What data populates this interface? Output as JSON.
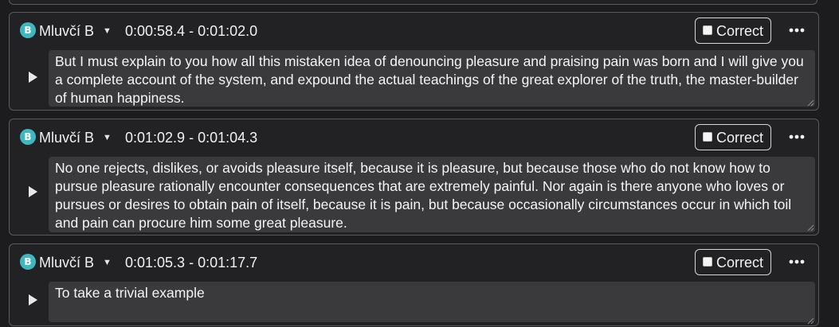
{
  "segments": [
    {
      "badge": "B",
      "speaker": "Mluvčí B",
      "time_range": "0:00:58.4 - 0:01:02.0",
      "correct_label": "Correct",
      "text": "But I must explain to you how all this mistaken idea of denouncing pleasure and praising pain was born and I will give you a complete account of the system, and expound the actual teachings of the great explorer of the truth, the master-builder of human happiness."
    },
    {
      "badge": "B",
      "speaker": "Mluvčí B",
      "time_range": "0:01:02.9 - 0:01:04.3",
      "correct_label": "Correct",
      "text": "No one rejects, dislikes, or avoids pleasure itself, because it is pleasure, but because those who do not know how to pursue pleasure rationally encounter consequences that are extremely painful. Nor again is there anyone who loves or pursues or desires to obtain pain of itself, because it is pain, but because occasionally circumstances occur in which toil and pain can procure him some great pleasure."
    },
    {
      "badge": "B",
      "speaker": "Mluvčí B",
      "time_range": "0:01:05.3 - 0:01:17.7",
      "correct_label": "Correct",
      "text": "To take a trivial example"
    }
  ],
  "icons": {
    "speaker_caret": "caret-down-icon",
    "more": "more-horizontal-icon",
    "play": "play-icon",
    "checkbox": "checkbox-unchecked-icon"
  },
  "colors": {
    "background": "#1c1c1e",
    "card": "#222224",
    "card_border": "#5a5a5e",
    "badge": "#3fb7c0",
    "textarea": "#3a3a3c"
  }
}
